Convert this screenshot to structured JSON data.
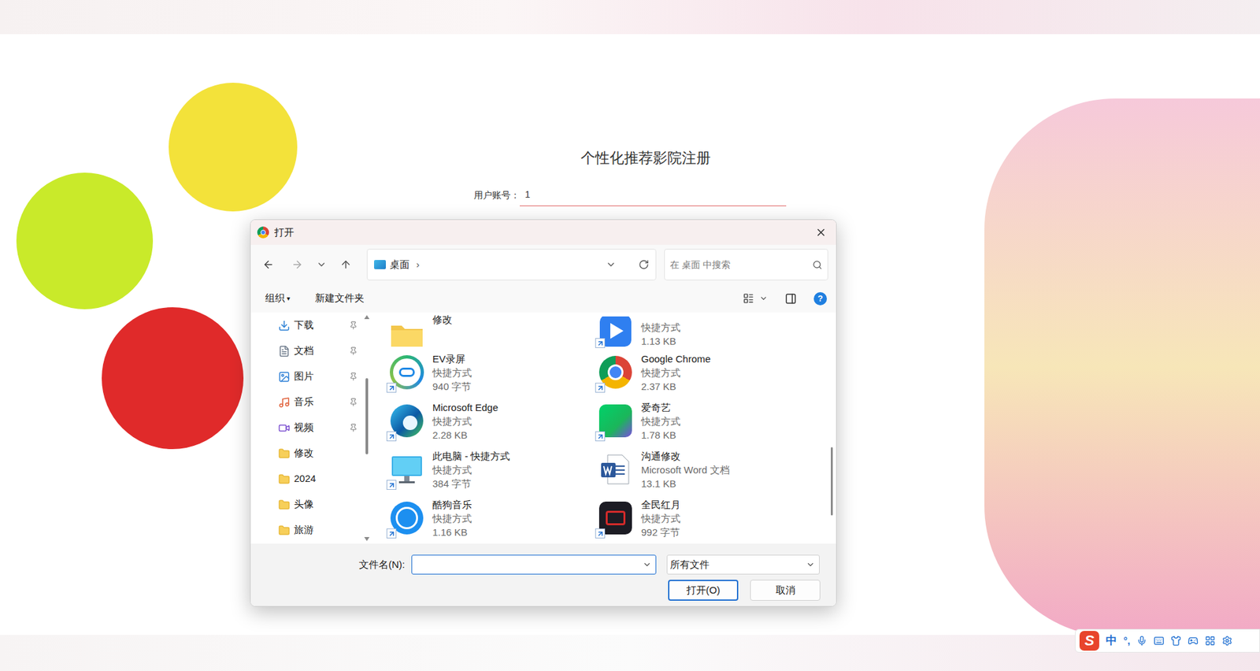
{
  "page": {
    "title": "个性化推荐影院注册",
    "fields": [
      {
        "label": "用户账号：",
        "value": "1"
      }
    ]
  },
  "dialog": {
    "title": "打开",
    "address": {
      "location": "桌面",
      "separator": "›"
    },
    "search": {
      "placeholder": "在 桌面 中搜索"
    },
    "toolbar": {
      "organize": "组织",
      "caret": "▾",
      "new_folder": "新建文件夹",
      "help": "?"
    },
    "nav": [
      {
        "label": "下载",
        "pinned": true
      },
      {
        "label": "文档",
        "pinned": true
      },
      {
        "label": "图片",
        "pinned": true
      },
      {
        "label": "音乐",
        "pinned": true
      },
      {
        "label": "视频",
        "pinned": true
      },
      {
        "label": "修改",
        "pinned": false
      },
      {
        "label": "2024",
        "pinned": false
      },
      {
        "label": "头像",
        "pinned": false
      },
      {
        "label": "旅游",
        "pinned": false
      }
    ],
    "files": [
      {
        "kind": "folder",
        "name": "修改",
        "partial": true
      },
      {
        "kind": "shortcut",
        "type": "快捷方式",
        "size": "1.13 KB",
        "partial": true
      },
      {
        "kind": "shortcut",
        "name": "EV录屏",
        "type": "快捷方式",
        "size": "940 字节",
        "partial": false
      },
      {
        "kind": "shortcut",
        "name": "Google Chrome",
        "type": "快捷方式",
        "size": "2.37 KB",
        "partial": false
      },
      {
        "kind": "shortcut",
        "name": "Microsoft Edge",
        "type": "快捷方式",
        "size": "2.28 KB",
        "partial": false
      },
      {
        "kind": "shortcut",
        "name": "爱奇艺",
        "type": "快捷方式",
        "size": "1.78 KB",
        "partial": false
      },
      {
        "kind": "shortcut",
        "name": "此电脑 - 快捷方式",
        "type": "快捷方式",
        "size": "384 字节",
        "partial": false
      },
      {
        "kind": "document",
        "name": "沟通修改",
        "type": "Microsoft Word 文档",
        "size": "13.1 KB",
        "partial": false
      },
      {
        "kind": "shortcut",
        "name": "酷狗音乐",
        "type": "快捷方式",
        "size": "1.16 KB",
        "partial": false
      },
      {
        "kind": "shortcut",
        "name": "全民红月",
        "type": "快捷方式",
        "size": "992 字节",
        "partial": false
      }
    ],
    "filename": {
      "label": "文件名(N):",
      "value": "",
      "focused": true
    },
    "filter": "所有文件",
    "buttons": [
      {
        "label": "打开(O)",
        "default": true
      },
      {
        "label": "取消",
        "default": false
      }
    ]
  },
  "ime": {
    "logo": "S",
    "mode": "中",
    "punct": "°,"
  }
}
